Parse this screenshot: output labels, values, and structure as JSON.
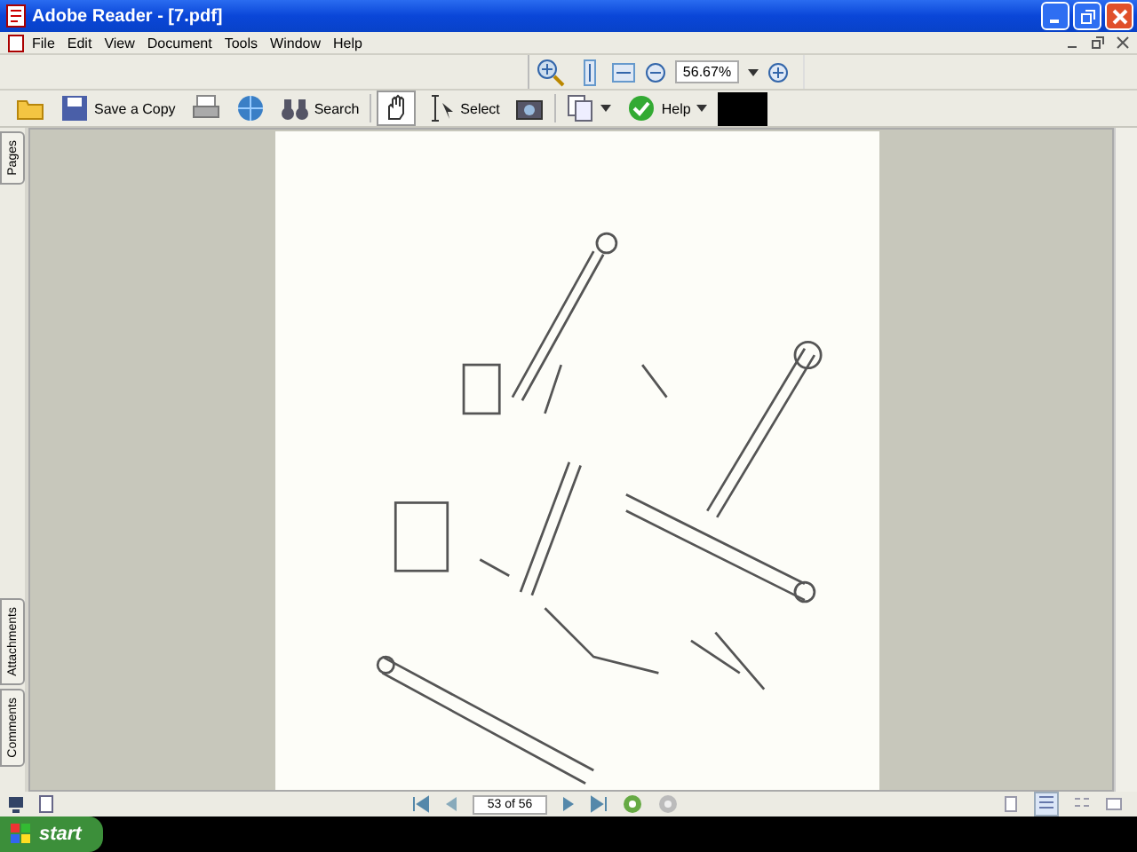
{
  "window": {
    "title": "Adobe Reader - [7.pdf]"
  },
  "menu": [
    "File",
    "Edit",
    "View",
    "Document",
    "Tools",
    "Window",
    "Help"
  ],
  "zoom_toolbar": {
    "zoom": "56.67%"
  },
  "toolbar": [
    {
      "kind": "open"
    },
    {
      "kind": "save",
      "label": "Save a Copy"
    },
    {
      "kind": "print"
    },
    {
      "kind": "email"
    },
    {
      "kind": "search",
      "label": "Search"
    },
    {
      "kind": "hand",
      "selected": true
    },
    {
      "kind": "select",
      "label": "Select"
    },
    {
      "kind": "snapshot"
    },
    {
      "kind": "rotate"
    },
    {
      "kind": "help",
      "label": "Help"
    }
  ],
  "side_tabs_top": [
    "Pages"
  ],
  "side_tabs_bottom": [
    "Attachments",
    "Comments"
  ],
  "navigation": {
    "page": "53 of 56"
  },
  "taskbar": {
    "start": "start"
  }
}
